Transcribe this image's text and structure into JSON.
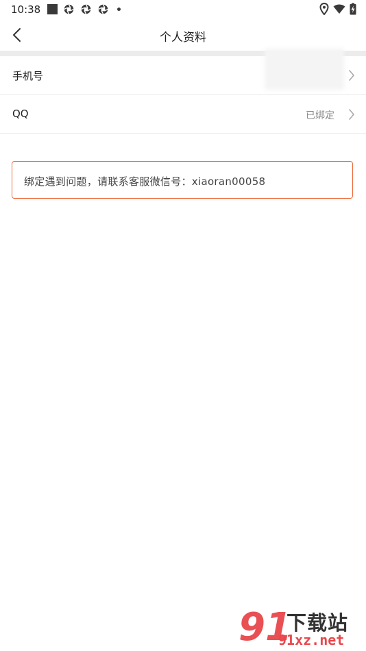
{
  "status_bar": {
    "time": "10:38"
  },
  "nav": {
    "title": "个人资料"
  },
  "rows": [
    {
      "label": "手机号",
      "value": ""
    },
    {
      "label": "QQ",
      "value": "已绑定"
    }
  ],
  "notice": {
    "text": "绑定遇到问题，请联系客服微信号：xiaoran00058"
  },
  "watermark": {
    "logo": "91",
    "title": "下载站",
    "domain": "91xz.net"
  },
  "colors": {
    "accent": "#ec6a3c",
    "watermark_red": "#e8474b"
  }
}
